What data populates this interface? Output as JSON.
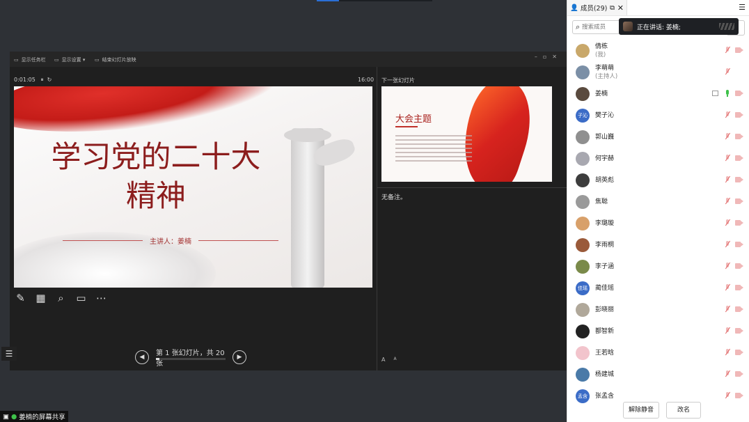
{
  "toolbar": {
    "show_taskbar": "显示任务栏",
    "display_settings": "显示设置 ▾",
    "end_show": "结束幻灯片放映"
  },
  "presenter": {
    "elapsed": "0:01:05",
    "clock": "16:00",
    "next_label": "下一张幻灯片",
    "notes": "无备注。",
    "font_up": "A",
    "font_down": "A",
    "page_info": "第 1 张幻灯片，共 20 张",
    "progress": 0.05
  },
  "slide": {
    "title": "学习党的二十大精神",
    "presenter_line": "主讲人：姜楠"
  },
  "next_slide": {
    "title": "大会主题"
  },
  "share_tag": "姜楠的屏幕共享",
  "panel": {
    "tab_label": "成员(29)",
    "search_placeholder": "搜索成员",
    "speaking_label": "正在讲话:  姜楠;",
    "mute_all_label": "解除静音",
    "rename_label": "改名"
  },
  "members": [
    {
      "name": "倩栋",
      "sub": "(我)",
      "avatar_text": "",
      "avatar_color": "#c9a86a",
      "mic": "off",
      "cam": true,
      "screen": false
    },
    {
      "name": "李萌萌",
      "sub": "(主持人)",
      "avatar_text": "",
      "avatar_color": "#7b8fa6",
      "mic": "off",
      "cam": false,
      "screen": false
    },
    {
      "name": "姜楠",
      "sub": "",
      "avatar_text": "",
      "avatar_color": "#5a4a3e",
      "mic": "on",
      "cam": true,
      "screen": true
    },
    {
      "name": "樊子沁",
      "sub": "",
      "avatar_text": "子沁",
      "avatar_color": "#3b6cc7",
      "mic": "off",
      "cam": true,
      "screen": false
    },
    {
      "name": "郭山巍",
      "sub": "",
      "avatar_text": "",
      "avatar_color": "#8f8f8f",
      "mic": "off",
      "cam": true,
      "screen": false
    },
    {
      "name": "何宇赫",
      "sub": "",
      "avatar_text": "",
      "avatar_color": "#a8a8b0",
      "mic": "off",
      "cam": true,
      "screen": false
    },
    {
      "name": "胡英彪",
      "sub": "",
      "avatar_text": "",
      "avatar_color": "#3d3d3d",
      "mic": "off",
      "cam": true,
      "screen": false
    },
    {
      "name": "焦聪",
      "sub": "",
      "avatar_text": "",
      "avatar_color": "#9a9a9a",
      "mic": "off",
      "cam": true,
      "screen": false
    },
    {
      "name": "李璐璇",
      "sub": "",
      "avatar_text": "",
      "avatar_color": "#d8a06a",
      "mic": "off",
      "cam": true,
      "screen": false
    },
    {
      "name": "李雨桐",
      "sub": "",
      "avatar_text": "",
      "avatar_color": "#9a5a3a",
      "mic": "off",
      "cam": true,
      "screen": false
    },
    {
      "name": "李子涵",
      "sub": "",
      "avatar_text": "",
      "avatar_color": "#7a8a4a",
      "mic": "off",
      "cam": true,
      "screen": false
    },
    {
      "name": "蔺佳瑶",
      "sub": "",
      "avatar_text": "佳瑶",
      "avatar_color": "#3b6cc7",
      "mic": "off",
      "cam": true,
      "screen": false
    },
    {
      "name": "彭晓丽",
      "sub": "",
      "avatar_text": "",
      "avatar_color": "#b0a89a",
      "mic": "off",
      "cam": true,
      "screen": false
    },
    {
      "name": "鄯智新",
      "sub": "",
      "avatar_text": "",
      "avatar_color": "#222222",
      "mic": "off",
      "cam": true,
      "screen": false
    },
    {
      "name": "王若晗",
      "sub": "",
      "avatar_text": "",
      "avatar_color": "#f2c4cc",
      "mic": "off",
      "cam": true,
      "screen": false
    },
    {
      "name": "杨建城",
      "sub": "",
      "avatar_text": "",
      "avatar_color": "#4a7aa8",
      "mic": "off",
      "cam": true,
      "screen": false
    },
    {
      "name": "张孟含",
      "sub": "",
      "avatar_text": "孟含",
      "avatar_color": "#3b6cc7",
      "mic": "off",
      "cam": true,
      "screen": false
    }
  ]
}
